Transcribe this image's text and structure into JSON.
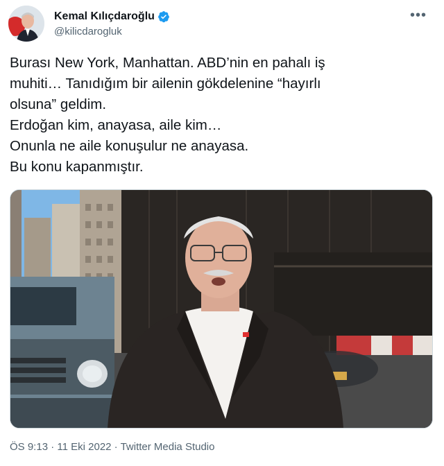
{
  "author": {
    "display_name": "Kemal Kılıçdaroğlu",
    "handle": "@kilicdarogluk",
    "verified": true,
    "avatar_icon": "profile-photo"
  },
  "more_icon": "more-horizontal-icon",
  "tweet": {
    "text": "Burası New York, Manhattan. ABD’nin en pahalı iş\nmuhiti… Tanıdığım bir ailenin gökdelenine “hayırlı\nolsuna” geldim.\nErdoğan kim, anayasa, aile kim…\nOnunla ne aile konuşulur ne anayasa.\nBu konu kapanmıştır."
  },
  "media": {
    "kind": "video-still"
  },
  "meta": {
    "time": "ÖS 9:13",
    "separator1": " · ",
    "date": "11 Eki 2022",
    "separator2": " · ",
    "source": "Twitter Media Studio"
  },
  "colors": {
    "verified_blue": "#1d9bf0",
    "secondary_text": "#536471",
    "primary_text": "#0f1419"
  }
}
